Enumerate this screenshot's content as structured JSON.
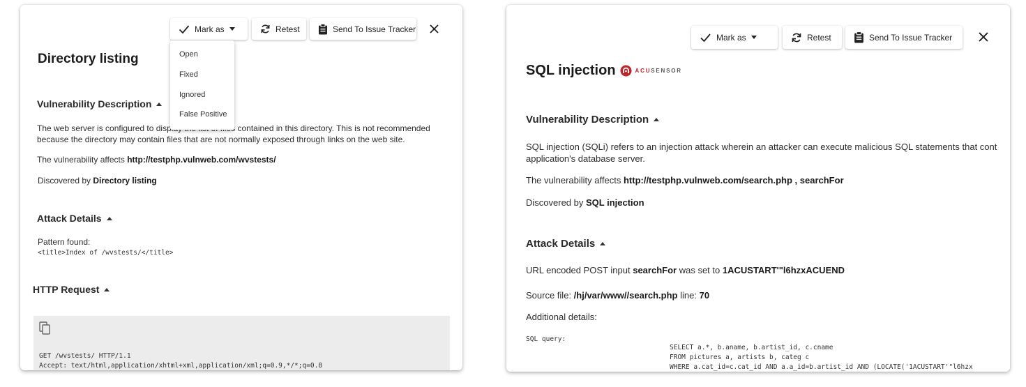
{
  "left": {
    "toolbar": {
      "mark_as_label": "Mark as",
      "retest_label": "Retest",
      "issue_tracker_label": "Send To Issue Tracker"
    },
    "dropdown": {
      "options": [
        "Open",
        "Fixed",
        "Ignored",
        "False Positive"
      ]
    },
    "title": "Directory listing",
    "vuln_description": {
      "heading": "Vulnerability Description",
      "text_line1": "The web server is configured to display the list of files contained in this directory. This is not recommended",
      "text_line2": "because the directory may contain files that are not normally exposed through links on the web site.",
      "affects_prefix": "The vulnerability affects",
      "affects_url": "http://testphp.vulnweb.com/wvstests/",
      "discovered_prefix": "Discovered by",
      "discovered_by": "Directory listing"
    },
    "attack_details": {
      "heading": "Attack Details",
      "pattern_label": "Pattern found:",
      "pattern_value": "<title>Index of /wvstests/</title>"
    },
    "http_request": {
      "heading": "HTTP Request",
      "line1": "GET /wvstests/ HTTP/1.1",
      "line2": "Accept: text/html,application/xhtml+xml,application/xml;q=0.9,*/*;q=0.8"
    }
  },
  "right": {
    "toolbar": {
      "mark_as_label": "Mark as",
      "retest_label": "Retest",
      "issue_tracker_label": "Send To Issue Tracker"
    },
    "title": "SQL injection",
    "badge": {
      "brand_prefix": "ACU",
      "brand_suffix": "SENSOR",
      "color": "#c0252a"
    },
    "vuln_description": {
      "heading": "Vulnerability Description",
      "text_line1": "SQL injection (SQLi) refers to an injection attack wherein an attacker can execute malicious SQL statements that cont",
      "text_line2": "application's database server.",
      "affects_prefix": "The vulnerability affects",
      "affects_url": "http://testphp.vulnweb.com/search.php , searchFor",
      "discovered_prefix": "Discovered by",
      "discovered_by": "SQL injection"
    },
    "attack_details": {
      "heading": "Attack Details",
      "post_prefix": "URL encoded POST input",
      "post_param": "searchFor",
      "post_mid": "was set to",
      "post_value": "1ACUSTART'\"l6hzxACUEND",
      "source_prefix": "Source file:",
      "source_file": "/hj/var/www//search.php",
      "line_prefix": "line:",
      "line_number": "70",
      "additional_label": "Additional details:",
      "sql_label": "SQL query:",
      "sql_line1": "SELECT a.*, b.aname, b.artist_id, c.cname",
      "sql_line2": "FROM pictures a, artists b, categ c",
      "sql_line3": "WHERE a.cat_id=c.cat_id AND a.a_id=b.artist_id AND (LOCATE('1ACUSTART'\"l6hzx"
    }
  }
}
